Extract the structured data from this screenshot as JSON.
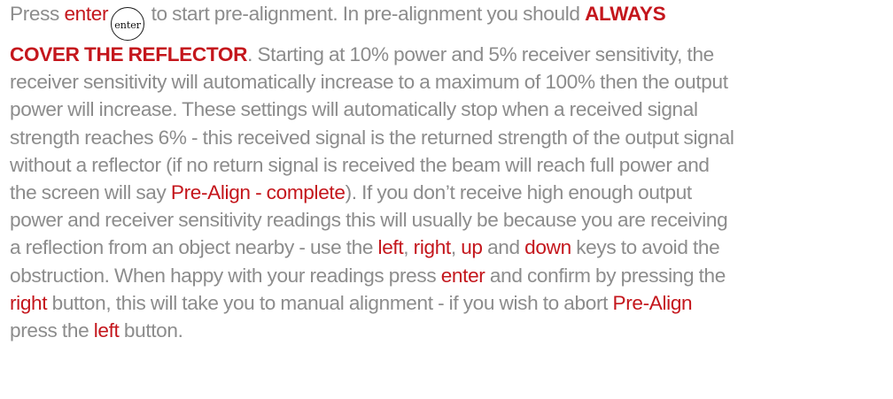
{
  "key_icon": {
    "label": "enter",
    "icon": "enter-key-icon"
  },
  "colors": {
    "body_text": "#8c8c8c",
    "highlight": "#c4161c"
  },
  "lines": [
    [
      {
        "t": "Press ",
        "c": "n"
      },
      {
        "t": "enter",
        "c": "r"
      },
      {
        "icon": true
      },
      {
        "t": " to start pre-alignment. In pre-alignment you should ",
        "c": "n"
      },
      {
        "t": "ALWAYS",
        "c": "rb"
      }
    ],
    [
      {
        "t": "COVER THE REFLECTOR",
        "c": "rb"
      },
      {
        "t": ". Starting at 10% power and 5% receiver sensitivity, the",
        "c": "n"
      }
    ],
    [
      {
        "t": "receiver sensitivity will automatically increase to a maximum of 100% then the output",
        "c": "n"
      }
    ],
    [
      {
        "t": "power will increase. These settings will automatically stop when a received signal",
        "c": "n"
      }
    ],
    [
      {
        "t": "strength reaches 6% - this received signal is the returned strength of the output signal",
        "c": "n"
      }
    ],
    [
      {
        "t": "without a reflector (if no return signal is received the beam will reach full power and",
        "c": "n"
      }
    ],
    [
      {
        "t": "the screen will say ",
        "c": "n"
      },
      {
        "t": "Pre-Align - complete",
        "c": "r"
      },
      {
        "t": "). If you don’t receive high enough output",
        "c": "n"
      }
    ],
    [
      {
        "t": "power and receiver sensitivity readings this will usually be because you are receiving",
        "c": "n"
      }
    ],
    [
      {
        "t": "a reflection from an object nearby - use the ",
        "c": "n"
      },
      {
        "t": "left",
        "c": "r"
      },
      {
        "t": ", ",
        "c": "n"
      },
      {
        "t": "right",
        "c": "r"
      },
      {
        "t": ", ",
        "c": "n"
      },
      {
        "t": "up",
        "c": "r"
      },
      {
        "t": " and ",
        "c": "n"
      },
      {
        "t": "down",
        "c": "r"
      },
      {
        "t": " keys to avoid the",
        "c": "n"
      }
    ],
    [
      {
        "t": "obstruction. When happy with your readings press ",
        "c": "n"
      },
      {
        "t": "enter",
        "c": "r"
      },
      {
        "t": " and confirm by pressing the",
        "c": "n"
      }
    ],
    [
      {
        "t": "right",
        "c": "r"
      },
      {
        "t": " button, this will take you to manual alignment - if you wish to abort ",
        "c": "n"
      },
      {
        "t": "Pre-Align",
        "c": "r"
      }
    ],
    [
      {
        "t": "press the ",
        "c": "n"
      },
      {
        "t": "left",
        "c": "r"
      },
      {
        "t": " button.",
        "c": "n"
      }
    ]
  ]
}
